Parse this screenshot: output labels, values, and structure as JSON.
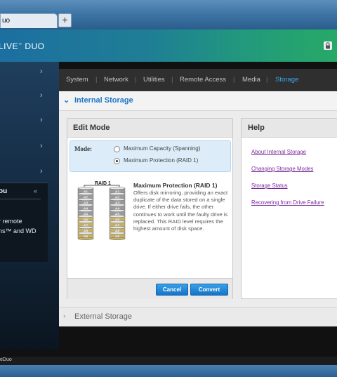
{
  "browser": {
    "tab_title": "uo",
    "new_tab_label": "+"
  },
  "header": {
    "brand_prefix": "LIVE",
    "brand_mark": "™",
    "brand_suffix": " DUO"
  },
  "sidebar": {
    "chevron": "›",
    "help_title": "ou",
    "help_close": "«",
    "help_line1": "r remote",
    "help_line2": "ns™ and WD"
  },
  "nav": {
    "tabs": [
      {
        "label": "System"
      },
      {
        "label": "Network"
      },
      {
        "label": "Utilities"
      },
      {
        "label": "Remote Access"
      },
      {
        "label": "Media"
      },
      {
        "label": "Storage",
        "active": true
      }
    ],
    "separator": "|"
  },
  "internal_storage": {
    "chevron": "⌄",
    "title": "Internal Storage"
  },
  "edit_mode": {
    "title": "Edit Mode",
    "mode_label": "Mode:",
    "options": [
      {
        "label": "Maximum Capacity (Spanning)",
        "selected": false
      },
      {
        "label": "Maximum Protection (RAID 1)",
        "selected": true
      }
    ],
    "raid_diagram_title": "RAID 1",
    "raid_blocks": [
      "A1",
      "A2",
      "A3",
      "A4",
      "A5",
      "A6",
      "A7",
      "A8",
      "A9"
    ],
    "description_title": "Maximum Protection (RAID 1)",
    "description": "Offers disk mirroring, providing an exact duplicate of the data stored on a single drive. If either drive fails, the other continues to work until the faulty drive is replaced. This RAID level requires the highest amount of disk space.",
    "cancel_label": "Cancel",
    "convert_label": "Convert"
  },
  "help": {
    "title": "Help",
    "links": [
      {
        "label": "About Internal Storage"
      },
      {
        "label": "Changing Storage Modes"
      },
      {
        "label": "Storage Status"
      },
      {
        "label": "Recovering from Drive Failure"
      }
    ]
  },
  "external_storage": {
    "chevron": "›",
    "title": "External Storage"
  },
  "status_bar": {
    "text": "eDuo"
  },
  "colors": {
    "accent": "#1a76c4",
    "link": "#7a2a9a",
    "raid_gray": "#9a9a9a",
    "raid_gold": "#c3b06a"
  }
}
